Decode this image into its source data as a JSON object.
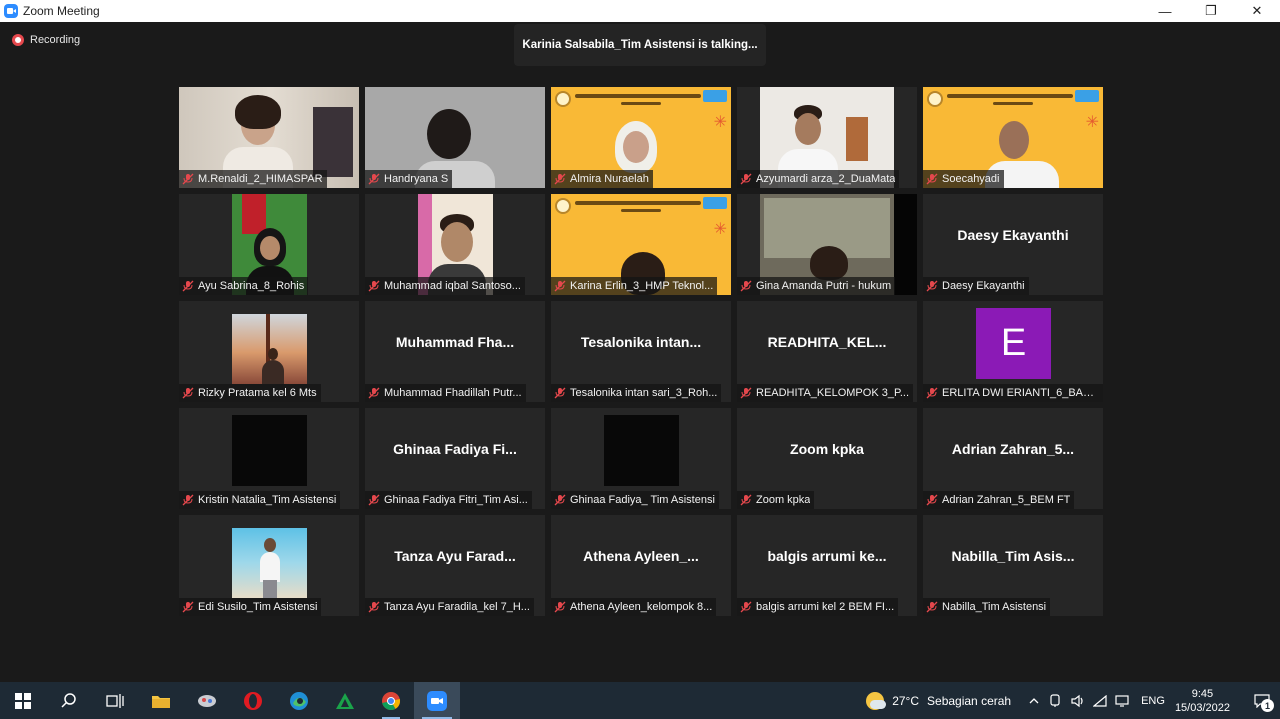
{
  "window": {
    "title": "Zoom Meeting",
    "minimize": "—",
    "maximize": "❐",
    "close": "✕"
  },
  "meeting": {
    "recording_label": "Recording",
    "talking_banner": "Karinia Salsabila_Tim Asistensi is talking...",
    "participants": [
      {
        "label": "M.Renaldi_2_HIMASPAR",
        "big": "",
        "kind": "room"
      },
      {
        "label": "Handryana S",
        "big": "",
        "kind": "grey"
      },
      {
        "label": "Almira Nuraelah",
        "big": "",
        "kind": "banner"
      },
      {
        "label": "Azyumardi arza_2_DuaMata",
        "big": "",
        "kind": "office"
      },
      {
        "label": "Soecahyadi",
        "big": "",
        "kind": "banner-man"
      },
      {
        "label": "Ayu Sabrina_8_Rohis",
        "big": "",
        "kind": "portrait-green"
      },
      {
        "label": "Muhammad iqbal Santoso...",
        "big": "",
        "kind": "portrait-pink"
      },
      {
        "label": "Karina Erlin_3_HMP Teknol...",
        "big": "",
        "kind": "banner-low"
      },
      {
        "label": "Gina Amanda Putri - hukum",
        "big": "",
        "kind": "painting"
      },
      {
        "label": "Daesy Ekayanthi",
        "big": "Daesy Ekayanthi",
        "kind": "name"
      },
      {
        "label": "Rizky Pratama kel 6 Mts",
        "big": "",
        "kind": "photo-sunset"
      },
      {
        "label": "Muhammad Fhadillah Putr...",
        "big": "Muhammad  Fha...",
        "kind": "name"
      },
      {
        "label": "Tesalonika intan sari_3_Roh...",
        "big": "Tesalonika  intan...",
        "kind": "name"
      },
      {
        "label": "READHITA_KELOMPOK 3_P...",
        "big": "READHITA_KEL...",
        "kind": "name"
      },
      {
        "label": "ERLITA DWI ERIANTI_6_BAS...",
        "big": "",
        "kind": "letter",
        "letter": "E"
      },
      {
        "label": "Kristin Natalia_Tim Asistensi",
        "big": "",
        "kind": "black"
      },
      {
        "label": "Ghinaa Fadiya Fitri_Tim Asi...",
        "big": "Ghinaa  Fadiya  Fi...",
        "kind": "name"
      },
      {
        "label": "Ghinaa Fadiya_ Tim Asistensi",
        "big": "",
        "kind": "black"
      },
      {
        "label": "Zoom kpka",
        "big": "Zoom  kpka",
        "kind": "name"
      },
      {
        "label": "Adrian Zahran_5_BEM FT",
        "big": "Adrian  Zahran_5...",
        "kind": "name"
      },
      {
        "label": "Edi Susilo_Tim Asistensi",
        "big": "",
        "kind": "photo-beach"
      },
      {
        "label": "Tanza Ayu Faradila_kel 7_H...",
        "big": "Tanza  Ayu  Farad...",
        "kind": "name"
      },
      {
        "label": "Athena Ayleen_kelompok 8...",
        "big": "Athena  Ayleen_...",
        "kind": "name"
      },
      {
        "label": "balgis arrumi kel 2 BEM FI...",
        "big": "balgis  arrumi  ke...",
        "kind": "name"
      },
      {
        "label": "Nabilla_Tim Asistensi",
        "big": "Nabilla_Tim  Asis...",
        "kind": "name"
      }
    ]
  },
  "taskbar": {
    "apps": [
      {
        "name": "start-button",
        "icon": "windows-icon"
      },
      {
        "name": "search-button",
        "icon": "search-icon"
      },
      {
        "name": "task-view-button",
        "icon": "task-view-icon"
      },
      {
        "name": "file-explorer-button",
        "icon": "folder-icon"
      },
      {
        "name": "app-button",
        "icon": "app-icon"
      },
      {
        "name": "opera-button",
        "icon": "opera-icon"
      },
      {
        "name": "edge-button",
        "icon": "edge-icon"
      },
      {
        "name": "app-green-button",
        "icon": "triangle-icon"
      },
      {
        "name": "chrome-button",
        "icon": "chrome-icon"
      },
      {
        "name": "zoom-button",
        "icon": "zoom-icon"
      }
    ],
    "weather_temp": "27°C",
    "weather_text": "Sebagian cerah",
    "language": "ENG",
    "time": "9:45",
    "date": "15/03/2022",
    "notification_count": "1"
  }
}
